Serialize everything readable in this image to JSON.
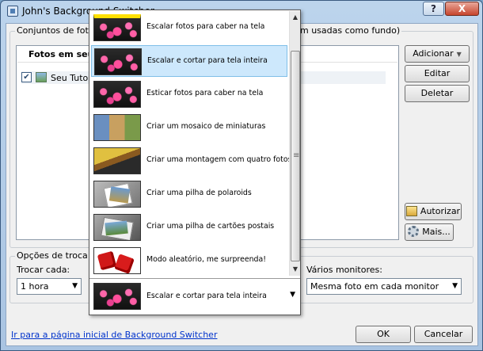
{
  "window": {
    "title": "John's Background Switcher",
    "help_label": "?",
    "close_label": "X"
  },
  "sets_group": {
    "label": "Conjuntos de fotos (",
    "label_tail": "m usadas como fundo)",
    "list_header": "Fotos em seu",
    "items": [
      {
        "label": "Seu Tutoria",
        "checked": true
      }
    ]
  },
  "side_buttons": {
    "add": "Adicionar",
    "edit": "Editar",
    "delete": "Deletar",
    "authorize": "Autorizar",
    "more": "Mais..."
  },
  "options_group": {
    "label": "Opções de troca",
    "change_every_label": "Trocar cada:",
    "change_every_value": "1 hora",
    "monitors_label": "Vários monitores:",
    "monitors_value": "Mesma foto em cada monitor"
  },
  "mode_dropdown": {
    "selected": "Escalar e cortar para tela inteira",
    "options": [
      {
        "label": "Escalar fotos para caber na tela",
        "icon": "flowers-thumbnail-icon"
      },
      {
        "label": "Escalar e cortar para tela inteira",
        "icon": "flowers-thumbnail-icon"
      },
      {
        "label": "Esticar fotos para caber na tela",
        "icon": "flowers-thumbnail-icon"
      },
      {
        "label": "Criar um mosaico de miniaturas",
        "icon": "mosaic-thumbnail-icon"
      },
      {
        "label": "Criar uma montagem com quatro fotos",
        "icon": "montage-thumbnail-icon"
      },
      {
        "label": "Criar uma pilha de polaroids",
        "icon": "polaroid-thumbnail-icon"
      },
      {
        "label": "Criar uma pilha de cartões postais",
        "icon": "postcard-thumbnail-icon"
      },
      {
        "label": "Modo aleatório, me surpreenda!",
        "icon": "dice-thumbnail-icon"
      }
    ]
  },
  "footer": {
    "link": "Ir para a página inicial de Background Switcher",
    "ok": "OK",
    "cancel": "Cancelar"
  }
}
